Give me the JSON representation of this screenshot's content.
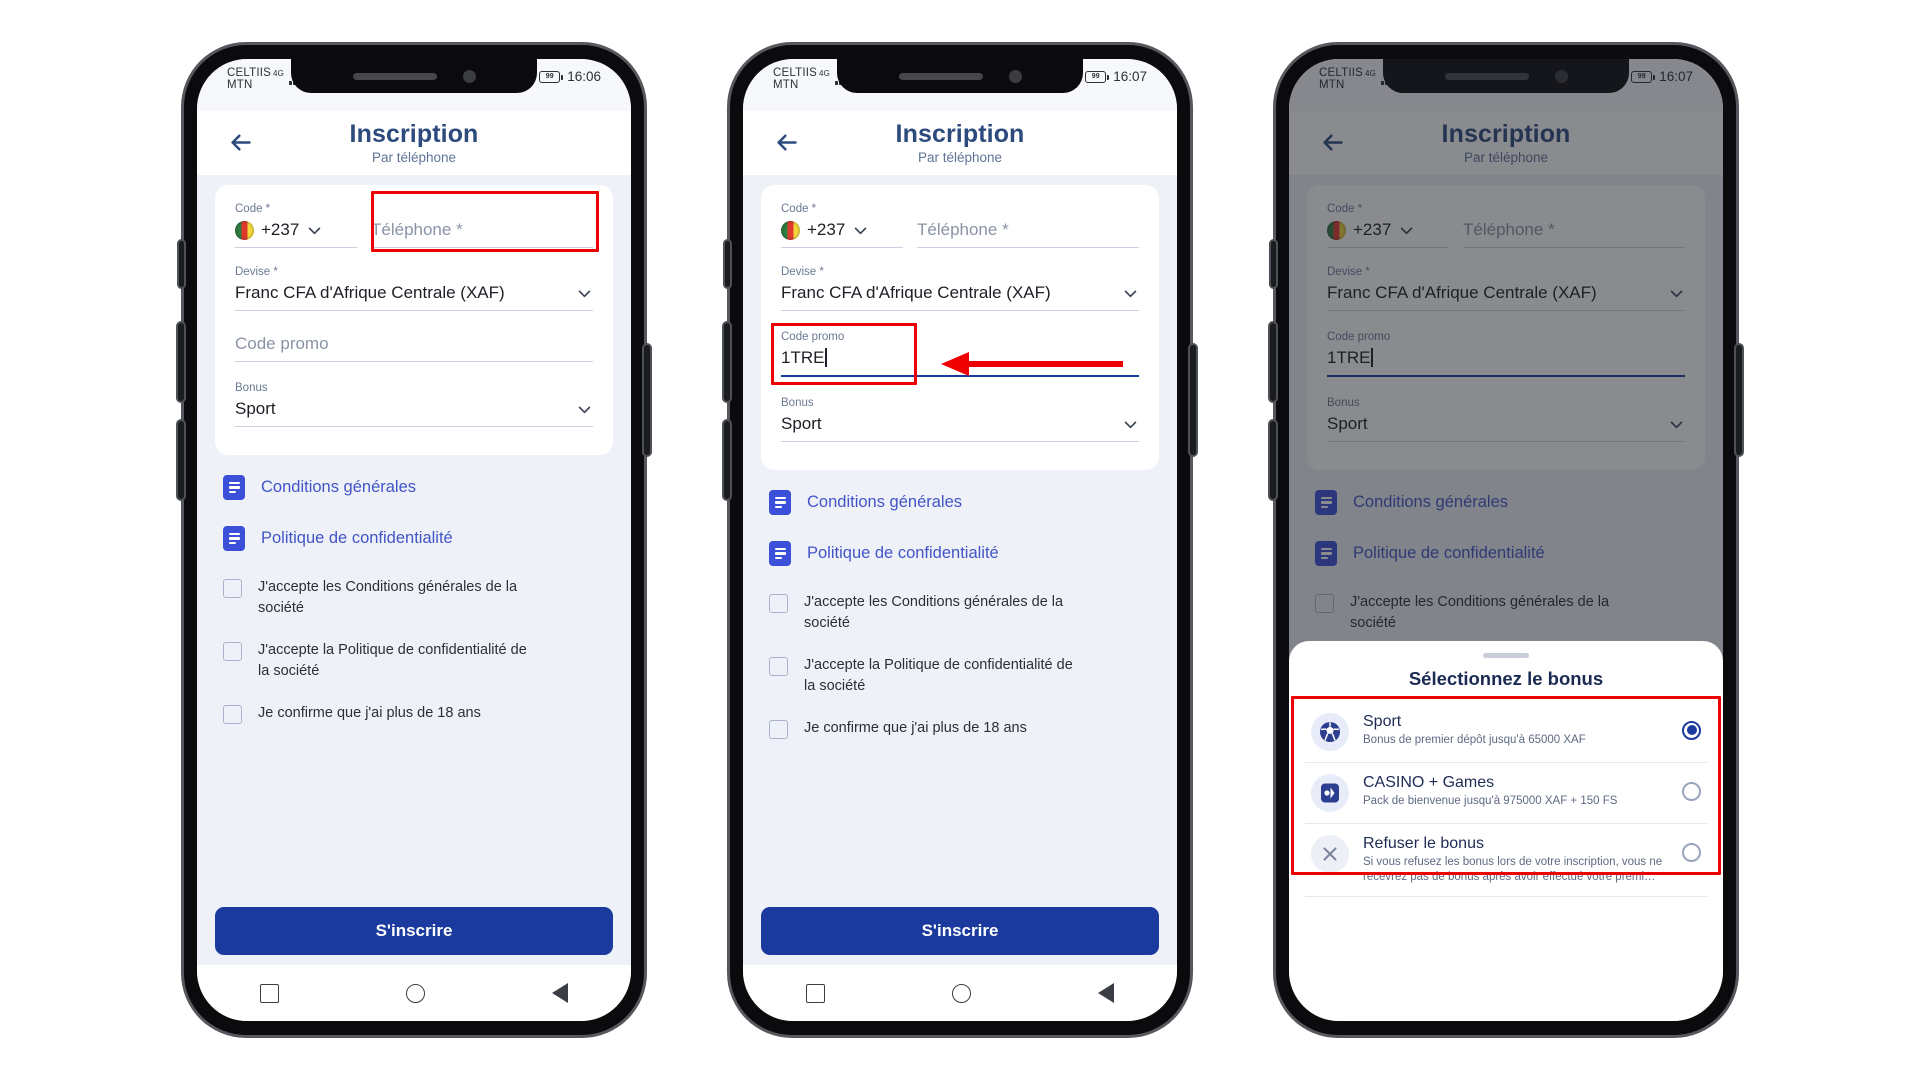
{
  "phones": [
    {
      "id": "phone-1",
      "status": {
        "carrier_line1": "CELTIIS",
        "network": "4G",
        "carrier_line2": "MTN",
        "battery": "99",
        "time": "16:06"
      },
      "header": {
        "title": "Inscription",
        "subtitle": "Par téléphone",
        "back_icon": "back-arrow-icon"
      },
      "form": {
        "code_label": "Code *",
        "code_value": "+237",
        "phone_placeholder": "Téléphone *",
        "currency_label": "Devise *",
        "currency_value": "Franc CFA d'Afrique Centrale (XAF)",
        "promo_label": "Code promo",
        "promo_value": "",
        "promo_placeholder": "Code promo",
        "bonus_label": "Bonus",
        "bonus_value": "Sport"
      },
      "docs": [
        {
          "label": "Conditions générales"
        },
        {
          "label": "Politique de confidentialité"
        }
      ],
      "consents": [
        {
          "label": "J'accepte les Conditions générales de la société",
          "checked": false
        },
        {
          "label": "J'accepte la Politique de confidentialité de la société",
          "checked": false
        },
        {
          "label": "Je confirme que j'ai plus de 18 ans",
          "checked": false
        }
      ],
      "submit_label": "S'inscrire",
      "annotation": "phone-field-highlight"
    },
    {
      "id": "phone-2",
      "status": {
        "carrier_line1": "CELTIIS",
        "network": "4G",
        "carrier_line2": "MTN",
        "battery": "99",
        "time": "16:07"
      },
      "header": {
        "title": "Inscription",
        "subtitle": "Par téléphone",
        "back_icon": "back-arrow-icon"
      },
      "form": {
        "code_label": "Code *",
        "code_value": "+237",
        "phone_placeholder": "Téléphone *",
        "currency_label": "Devise *",
        "currency_value": "Franc CFA d'Afrique Centrale (XAF)",
        "promo_label": "Code promo",
        "promo_value": "1TRE",
        "promo_placeholder": "Code promo",
        "bonus_label": "Bonus",
        "bonus_value": "Sport"
      },
      "docs": [
        {
          "label": "Conditions générales"
        },
        {
          "label": "Politique de confidentialité"
        }
      ],
      "consents": [
        {
          "label": "J'accepte les Conditions générales de la société",
          "checked": false
        },
        {
          "label": "J'accepte la Politique de confidentialité de la société",
          "checked": false
        },
        {
          "label": "Je confirme que j'ai plus de 18 ans",
          "checked": false
        }
      ],
      "submit_label": "S'inscrire",
      "annotation": "promo-field-highlight-with-arrow"
    },
    {
      "id": "phone-3",
      "status": {
        "carrier_line1": "CELTIIS",
        "network": "4G",
        "carrier_line2": "MTN",
        "battery": "99",
        "time": "16:07"
      },
      "header": {
        "title": "Inscription",
        "subtitle": "Par téléphone",
        "back_icon": "back-arrow-icon"
      },
      "form": {
        "code_label": "Code *",
        "code_value": "+237",
        "phone_placeholder": "Téléphone *",
        "currency_label": "Devise *",
        "currency_value": "Franc CFA d'Afrique Centrale (XAF)",
        "promo_label": "Code promo",
        "promo_value": "1TRE",
        "promo_placeholder": "Code promo",
        "bonus_label": "Bonus",
        "bonus_value": "Sport"
      },
      "docs": [
        {
          "label": "Conditions générales"
        },
        {
          "label": "Politique de confidentialité"
        }
      ],
      "consents": [
        {
          "label": "J'accepte les Conditions générales de la société",
          "checked": false
        },
        {
          "label": "J'accepte la Politique de confidentialité de la société",
          "checked": false
        },
        {
          "label": "Je confirme que j'ai plus de 18 ans",
          "checked": false
        }
      ],
      "submit_label": "S'inscrire",
      "sheet": {
        "title": "Sélectionnez le bonus",
        "options": [
          {
            "name": "Sport",
            "desc": "Bonus de premier dépôt jusqu'à 65000 XAF",
            "icon": "football-icon",
            "selected": true
          },
          {
            "name": "CASINO + Games",
            "desc": "Pack de bienvenue jusqu'à 975000 XAF + 150 FS",
            "icon": "casino-icon",
            "selected": false
          },
          {
            "name": "Refuser le bonus",
            "desc": "Si vous refusez les bonus lors de votre inscription, vous ne recevrez pas de bonus après avoir effectué votre premi…",
            "icon": "close-circle-icon",
            "selected": false
          }
        ]
      },
      "annotation": "bonus-options-highlight"
    }
  ],
  "colors": {
    "accent": "#1a3a9e",
    "link": "#4255c6",
    "title": "#2c4a7c",
    "annotation": "#ee0000",
    "screen_bg": "#eef1f8",
    "card_bg": "#ffffff"
  },
  "nav": {
    "recent_icon": "square-icon",
    "home_icon": "circle-icon",
    "back_icon": "triangle-back-icon"
  }
}
